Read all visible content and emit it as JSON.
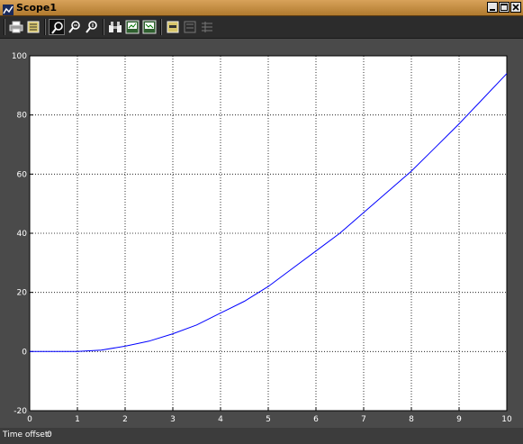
{
  "window": {
    "title": "Scope1"
  },
  "toolbar": {
    "buttons": [
      {
        "name": "print-button",
        "icon": "printer-icon"
      },
      {
        "name": "parameters-button",
        "icon": "parameters-icon"
      },
      {
        "name": "zoom-button",
        "icon": "zoom-icon",
        "pressed": true
      },
      {
        "name": "zoom-x-button",
        "icon": "zoom-x-icon"
      },
      {
        "name": "zoom-y-button",
        "icon": "zoom-y-icon"
      },
      {
        "name": "autoscale-button",
        "icon": "binoculars-icon"
      },
      {
        "name": "save-axes-button",
        "icon": "save-axes-icon"
      },
      {
        "name": "restore-axes-button",
        "icon": "restore-axes-icon"
      },
      {
        "name": "floating-scope-button",
        "icon": "floating-scope-icon"
      },
      {
        "name": "lock-axes-button",
        "icon": "lock-axes-icon",
        "disabled": true
      },
      {
        "name": "signal-selection-button",
        "icon": "signal-selection-icon",
        "disabled": true
      }
    ]
  },
  "status": {
    "label": "Time offset:",
    "value": "0"
  },
  "colors": {
    "line": "#0000ff",
    "grid": "#000000",
    "plot_background": "#ffffff",
    "frame": "#4a4a4a"
  },
  "chart_data": {
    "type": "line",
    "title": "",
    "xlabel": "",
    "ylabel": "",
    "xlim": [
      0,
      10
    ],
    "ylim": [
      -20,
      100
    ],
    "grid": true,
    "xticks": [
      0,
      1,
      2,
      3,
      4,
      5,
      6,
      7,
      8,
      9,
      10
    ],
    "yticks": [
      -20,
      0,
      20,
      40,
      60,
      80,
      100
    ],
    "series": [
      {
        "color": "#0000ff",
        "x": [
          0,
          0.5,
          1,
          1.5,
          2,
          2.5,
          3,
          3.5,
          4,
          4.5,
          5,
          5.5,
          6,
          6.5,
          7,
          7.5,
          8,
          8.5,
          9,
          9.5,
          10
        ],
        "y": [
          0,
          0,
          0,
          0.5,
          1.8,
          3.5,
          6,
          9,
          13,
          17,
          22,
          28,
          34,
          40,
          47,
          54,
          61,
          69,
          77,
          85.5,
          94
        ]
      }
    ]
  }
}
